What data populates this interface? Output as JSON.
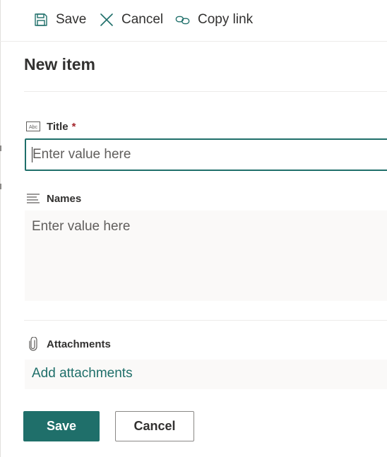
{
  "command_bar": {
    "save_label": "Save",
    "cancel_label": "Cancel",
    "copy_link_label": "Copy link"
  },
  "form": {
    "heading": "New item",
    "title_field": {
      "label": "Title",
      "required_marker": "*",
      "placeholder": "Enter value here",
      "value": ""
    },
    "names_field": {
      "label": "Names",
      "placeholder": "Enter value here",
      "value": ""
    },
    "attachments": {
      "label": "Attachments",
      "link_text": "Add attachments"
    }
  },
  "footer": {
    "save_label": "Save",
    "cancel_label": "Cancel"
  },
  "icons": {
    "save": "save-icon",
    "cancel": "close-icon",
    "copy_link": "link-icon",
    "title_type": "text-field-icon",
    "names_type": "multiline-text-icon",
    "attachments": "paperclip-icon"
  },
  "colors": {
    "accent": "#1f6f6a",
    "required": "#a4262c",
    "text": "#323130",
    "placeholder": "#605e5c",
    "field_background": "#faf9f8",
    "divider": "#edebe9"
  }
}
